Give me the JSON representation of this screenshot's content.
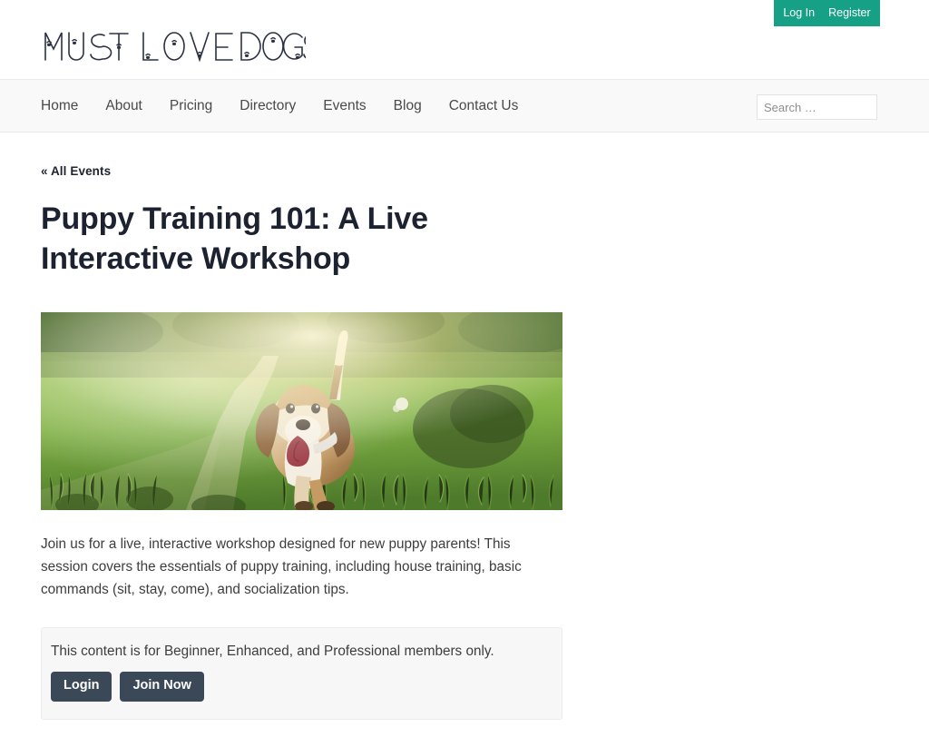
{
  "topbar": {
    "login_label": "Log In",
    "register_label": "Register",
    "accent_color": "#16a085"
  },
  "header": {
    "logo_text": "MUST LOVE DOGS",
    "logo_color": "#2c3243"
  },
  "nav": {
    "items": [
      {
        "label": "Home"
      },
      {
        "label": "About"
      },
      {
        "label": "Pricing"
      },
      {
        "label": "Directory"
      },
      {
        "label": "Events"
      },
      {
        "label": "Blog"
      },
      {
        "label": "Contact Us"
      }
    ],
    "search": {
      "placeholder": "Search …",
      "value": ""
    }
  },
  "main": {
    "back_link": "« All Events",
    "title": "Puppy Training 101: A Live Interactive Workshop",
    "featured_image_alt": "Beagle dog running along a sunlit grassy path",
    "description": "Join us for a live, interactive workshop designed for new puppy parents! This session covers the essentials of puppy training, including house training, basic commands (sit, stay, come), and socialization tips.",
    "restriction": {
      "message": "This content is for Beginner, Enhanced, and Professional members only.",
      "login_label": "Login",
      "join_label": "Join Now",
      "button_color": "#3b4857"
    }
  }
}
